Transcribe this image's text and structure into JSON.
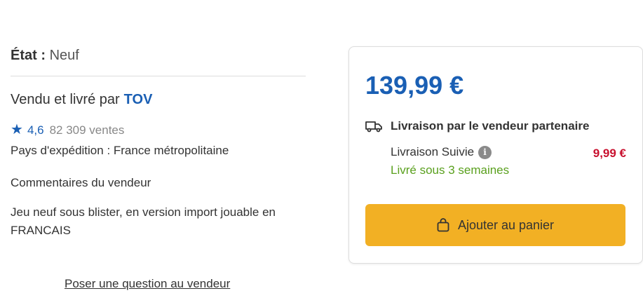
{
  "condition": {
    "label": "État :",
    "value": "Neuf"
  },
  "seller": {
    "prefix": "Vendu et livré par",
    "name": "TOV",
    "rating": "4,6",
    "sales": "82 309 ventes",
    "shipping_country": "Pays d'expédition : France métropolitaine",
    "comments_label": "Commentaires du vendeur",
    "comment": "Jeu neuf sous blister, en version import jouable en FRANCAIS",
    "ask_question": "Poser une question au vendeur"
  },
  "offer": {
    "price": "139,99 €",
    "delivery_title": "Livraison par le vendeur partenaire",
    "delivery_method": "Livraison Suivie",
    "delivery_price": "9,99 €",
    "delivery_eta": "Livré sous 3 semaines",
    "cart_button": "Ajouter au panier"
  },
  "icons": {
    "star": "star-icon",
    "truck": "truck-icon",
    "info": "info-icon",
    "bag": "shopping-bag-icon"
  },
  "colors": {
    "price": "#1a5fb4",
    "seller_link": "#1a5fb4",
    "delivery_price": "#c8102e",
    "eta": "#5aa01e",
    "button": "#f2b024"
  }
}
